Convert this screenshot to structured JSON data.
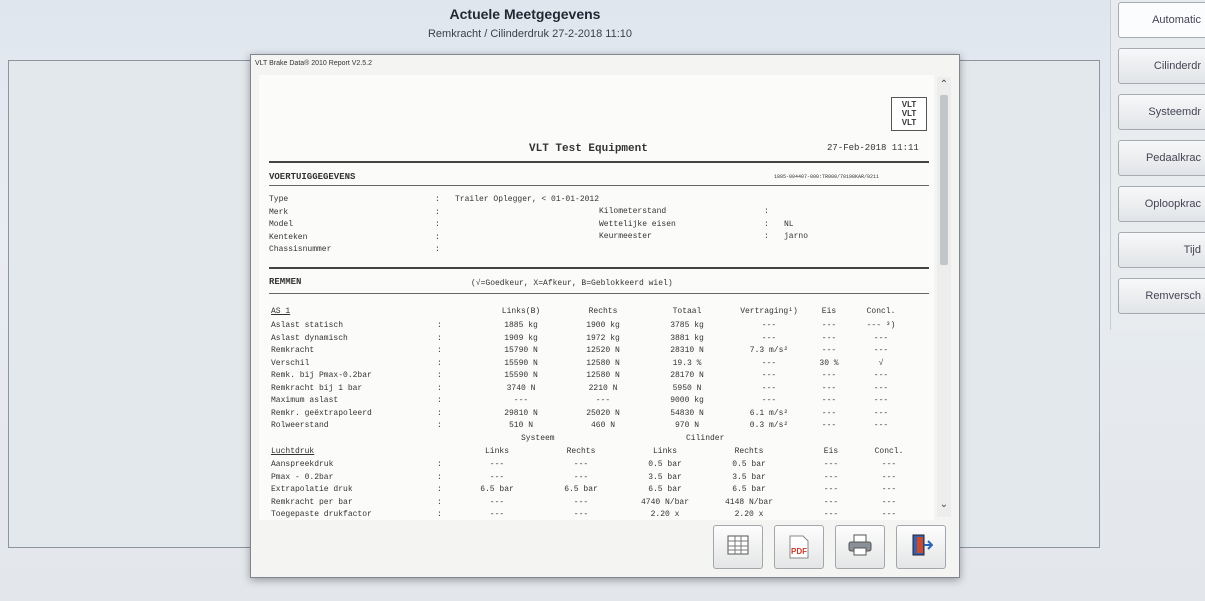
{
  "app": {
    "title": "Actuele Meetgegevens",
    "subtitle": "Remkracht / Cilinderdruk   27-2-2018 11:10"
  },
  "sidebar": {
    "buttons": [
      {
        "label": "Automatic"
      },
      {
        "label": "Cilinderdr"
      },
      {
        "label": "Systeemdr"
      },
      {
        "label": "Pedaalkrac"
      },
      {
        "label": "Oploopkrac"
      },
      {
        "label": "Tijd"
      },
      {
        "label": "Remversch"
      }
    ]
  },
  "dialog": {
    "title": "VLT Brake Data® 2010 Report V2.5.2"
  },
  "report": {
    "logo_lines": [
      "VLT",
      "VLT",
      "VLT"
    ],
    "company": "VLT Test Equipment",
    "datetime": "27-Feb-2018 11:11",
    "vehicle_section": "VOERTUIGGEGEVENS",
    "vehicle_id": "1895-004407-000:TR000/70198KAR/0211",
    "vehicle_fields": [
      {
        "label": "Type",
        "sep": ":",
        "value": "Trailer Oplegger, < 01-01-2012"
      },
      {
        "label": "Merk",
        "sep": ":",
        "value": ""
      },
      {
        "label": "Model",
        "sep": ":",
        "value": ""
      },
      {
        "label": "Kenteken",
        "sep": ":",
        "value": ""
      },
      {
        "label": "Chassisnummer",
        "sep": ":",
        "value": ""
      }
    ],
    "vehicle_fields_right": [
      {
        "label": "Kilometerstand",
        "sep": ":",
        "value": ""
      },
      {
        "label": "Wettelijke eisen",
        "sep": ":",
        "value": "NL"
      },
      {
        "label": "Keurmeester",
        "sep": ":",
        "value": "jarno"
      }
    ],
    "brakes_section": "REMMEN",
    "legend": "(√=Goedkeur, X=Afkeur, B=Geblokkeerd wiel)",
    "axle_label": "AS 1",
    "axle_headers": [
      "Links(B)",
      "Rechts",
      "Totaal",
      "Vertraging¹)",
      "Eis",
      "Concl."
    ],
    "axle_rows": [
      {
        "label": "Aslast statisch",
        "sep": ":",
        "cells": [
          "1885  kg",
          "1900  kg",
          "3785  kg",
          "---",
          "---",
          "--- ³)"
        ]
      },
      {
        "label": "Aslast dynamisch",
        "sep": ":",
        "cells": [
          "1909  kg",
          "1972  kg",
          "3881  kg",
          "---",
          "---",
          "---"
        ]
      },
      {
        "label": "Remkracht",
        "sep": ":",
        "cells": [
          "15790  N",
          "12520  N",
          "28310  N",
          "7.3  m/s²",
          "---",
          "---"
        ]
      },
      {
        "label": "Verschil",
        "sep": ":",
        "cells": [
          "15590  N",
          "12580  N",
          "19.3  %",
          "---",
          "30  %",
          "√"
        ]
      },
      {
        "label": "Remk. bij Pmax-0.2bar",
        "sep": ":",
        "cells": [
          "15590  N",
          "12580  N",
          "28170  N",
          "---",
          "---",
          "---"
        ]
      },
      {
        "label": "Remkracht bij 1 bar",
        "sep": ":",
        "cells": [
          "3740  N",
          "2210  N",
          "5950  N",
          "---",
          "---",
          "---"
        ]
      },
      {
        "label": "Maximum aslast",
        "sep": ":",
        "cells": [
          "---",
          "---",
          "9000  kg",
          "---",
          "---",
          "---"
        ]
      },
      {
        "label": "Remkr. geëxtrapoleerd",
        "sep": ":",
        "cells": [
          "29810  N",
          "25020  N",
          "54830  N",
          "6.1  m/s²",
          "---",
          "---"
        ]
      },
      {
        "label": "Rolweerstand",
        "sep": ":",
        "cells": [
          "510  N",
          "460  N",
          "970  N",
          "0.3  m/s²",
          "---",
          "---"
        ]
      }
    ],
    "group_headers": {
      "system": "Systeem",
      "cylinder": "Cilinder"
    },
    "air_label": "Luchtdruk",
    "air_headers": [
      "Links",
      "Rechts",
      "Links",
      "Rechts",
      "Eis",
      "Concl."
    ],
    "air_rows": [
      {
        "label": "Aanspreekdruk",
        "sep": ":",
        "cells": [
          "---",
          "---",
          "0.5  bar",
          "0.5  bar",
          "---",
          "---"
        ]
      },
      {
        "label": "Pmax - 0.2bar",
        "sep": ":",
        "cells": [
          "---",
          "---",
          "3.5  bar",
          "3.5  bar",
          "---",
          "---"
        ]
      },
      {
        "label": "Extrapolatie druk",
        "sep": ":",
        "cells": [
          "6.5  bar",
          "6.5  bar",
          "6.5  bar",
          "6.5  bar",
          "---",
          "---"
        ]
      },
      {
        "label": "Remkracht per bar",
        "sep": ":",
        "cells": [
          "---",
          "---",
          "4740  N/bar",
          "4148  N/bar",
          "---",
          "---"
        ]
      },
      {
        "label": "Toegepaste drukfactor",
        "sep": ":",
        "cells": [
          "---",
          "---",
          "2.20  x",
          "2.20  x",
          "---",
          "---"
        ]
      }
    ]
  },
  "toolbar": {
    "icons": [
      "spreadsheet-icon",
      "pdf-icon",
      "printer-icon",
      "exit-icon"
    ],
    "pdf_text": "PDF"
  },
  "colors": {
    "accent": "#c83a2a",
    "dialog_bg": "#f4f4f2"
  }
}
